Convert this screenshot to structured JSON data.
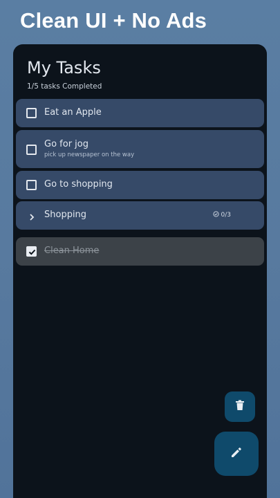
{
  "promo": {
    "headline": "Clean UI + No Ads"
  },
  "header": {
    "title": "My Tasks",
    "subtitle": "1/5 tasks Completed"
  },
  "tasks": [
    {
      "title": "Eat an Apple",
      "note": "",
      "checked": false
    },
    {
      "title": "Go for jog",
      "note": "pick up newspaper on the way",
      "checked": false
    },
    {
      "title": "Go to shopping",
      "note": "",
      "checked": false
    }
  ],
  "group": {
    "title": "Shopping",
    "progress": "0/3",
    "icon": "chevron-right-icon",
    "progress_icon": "check-circle-icon"
  },
  "completed": [
    {
      "title": "Clean Home",
      "checked": true
    }
  ],
  "actions": {
    "delete_icon": "trash-icon",
    "edit_icon": "pencil-icon"
  },
  "colors": {
    "accent": "#0f4a6b",
    "card": "#364a68",
    "card_done": "#3c4248",
    "surface": "#0c131b"
  }
}
